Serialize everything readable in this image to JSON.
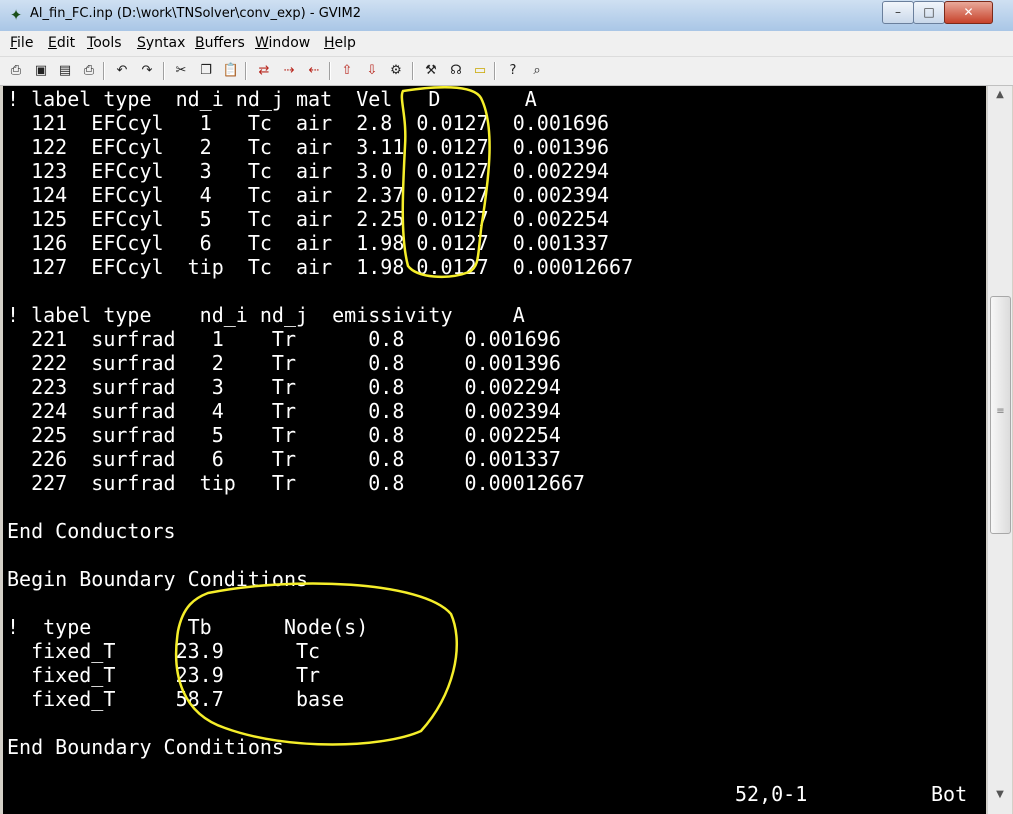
{
  "window": {
    "title": "Al_fin_FC.inp (D:\\work\\TNSolver\\conv_exp) - GVIM2",
    "controls": {
      "minimize": "–",
      "maximize": "□",
      "close": "✕"
    }
  },
  "menu": [
    {
      "label": "File",
      "mnemonic": "F",
      "rest": "ile"
    },
    {
      "label": "Edit",
      "mnemonic": "E",
      "rest": "dit"
    },
    {
      "label": "Tools",
      "mnemonic": "T",
      "rest": "ools"
    },
    {
      "label": "Syntax",
      "mnemonic": "S",
      "rest": "yntax"
    },
    {
      "label": "Buffers",
      "mnemonic": "B",
      "rest": "uffers"
    },
    {
      "label": "Window",
      "mnemonic": "W",
      "rest": "indow"
    },
    {
      "label": "Help",
      "mnemonic": "H",
      "rest": "elp"
    }
  ],
  "toolbar": [
    {
      "icon": "open-icon",
      "glyph": "⎙"
    },
    {
      "icon": "save-icon",
      "glyph": "▣"
    },
    {
      "icon": "save-all-icon",
      "glyph": "▤"
    },
    {
      "icon": "print-icon",
      "glyph": "⎙"
    },
    {
      "icon": "undo-icon",
      "glyph": "↶"
    },
    {
      "icon": "redo-icon",
      "glyph": "↷"
    },
    {
      "icon": "cut-icon",
      "glyph": "✂"
    },
    {
      "icon": "copy-icon",
      "glyph": "❐"
    },
    {
      "icon": "paste-icon",
      "glyph": "📋"
    },
    {
      "icon": "find-replace-icon",
      "glyph": "⇄"
    },
    {
      "icon": "find-next-icon",
      "glyph": "⇢"
    },
    {
      "icon": "find-prev-icon",
      "glyph": "⇠"
    },
    {
      "icon": "load-session-icon",
      "glyph": "⇧"
    },
    {
      "icon": "save-session-icon",
      "glyph": "⇩"
    },
    {
      "icon": "run-script-icon",
      "glyph": "⚙"
    },
    {
      "icon": "make-icon",
      "glyph": "⚒"
    },
    {
      "icon": "shell-icon",
      "glyph": "☊"
    },
    {
      "icon": "ctags-icon",
      "glyph": "▭"
    },
    {
      "icon": "help-icon",
      "glyph": "?"
    },
    {
      "icon": "find-help-icon",
      "glyph": "⌕"
    }
  ],
  "editor_lines": [
    "! label type  nd_i nd_j mat  Vel   D       A",
    "  121  EFCcyl   1   Tc  air  2.8  0.0127  0.001696",
    "  122  EFCcyl   2   Tc  air  3.11 0.0127  0.001396",
    "  123  EFCcyl   3   Tc  air  3.0  0.0127  0.002294",
    "  124  EFCcyl   4   Tc  air  2.37 0.0127  0.002394",
    "  125  EFCcyl   5   Tc  air  2.25 0.0127  0.002254",
    "  126  EFCcyl   6   Tc  air  1.98 0.0127  0.001337",
    "  127  EFCcyl  tip  Tc  air  1.98 0.0127  0.00012667",
    "",
    "! label type    nd_i nd_j  emissivity     A",
    "  221  surfrad   1    Tr      0.8     0.001696",
    "  222  surfrad   2    Tr      0.8     0.001396",
    "  223  surfrad   3    Tr      0.8     0.002294",
    "  224  surfrad   4    Tr      0.8     0.002394",
    "  225  surfrad   5    Tr      0.8     0.002254",
    "  226  surfrad   6    Tr      0.8     0.001337",
    "  227  surfrad  tip   Tr      0.8     0.00012667",
    "",
    "End Conductors",
    "",
    "Begin Boundary Conditions",
    "",
    "!  type        Tb      Node(s)",
    "  fixed_T     23.9      Tc",
    "  fixed_T     23.9      Tr",
    "  fixed_T     58.7      base",
    "",
    "End Boundary Conditions"
  ],
  "status": {
    "position": "52,0-1",
    "scroll": "Bot"
  },
  "annotation_color": "#f5ee2a"
}
